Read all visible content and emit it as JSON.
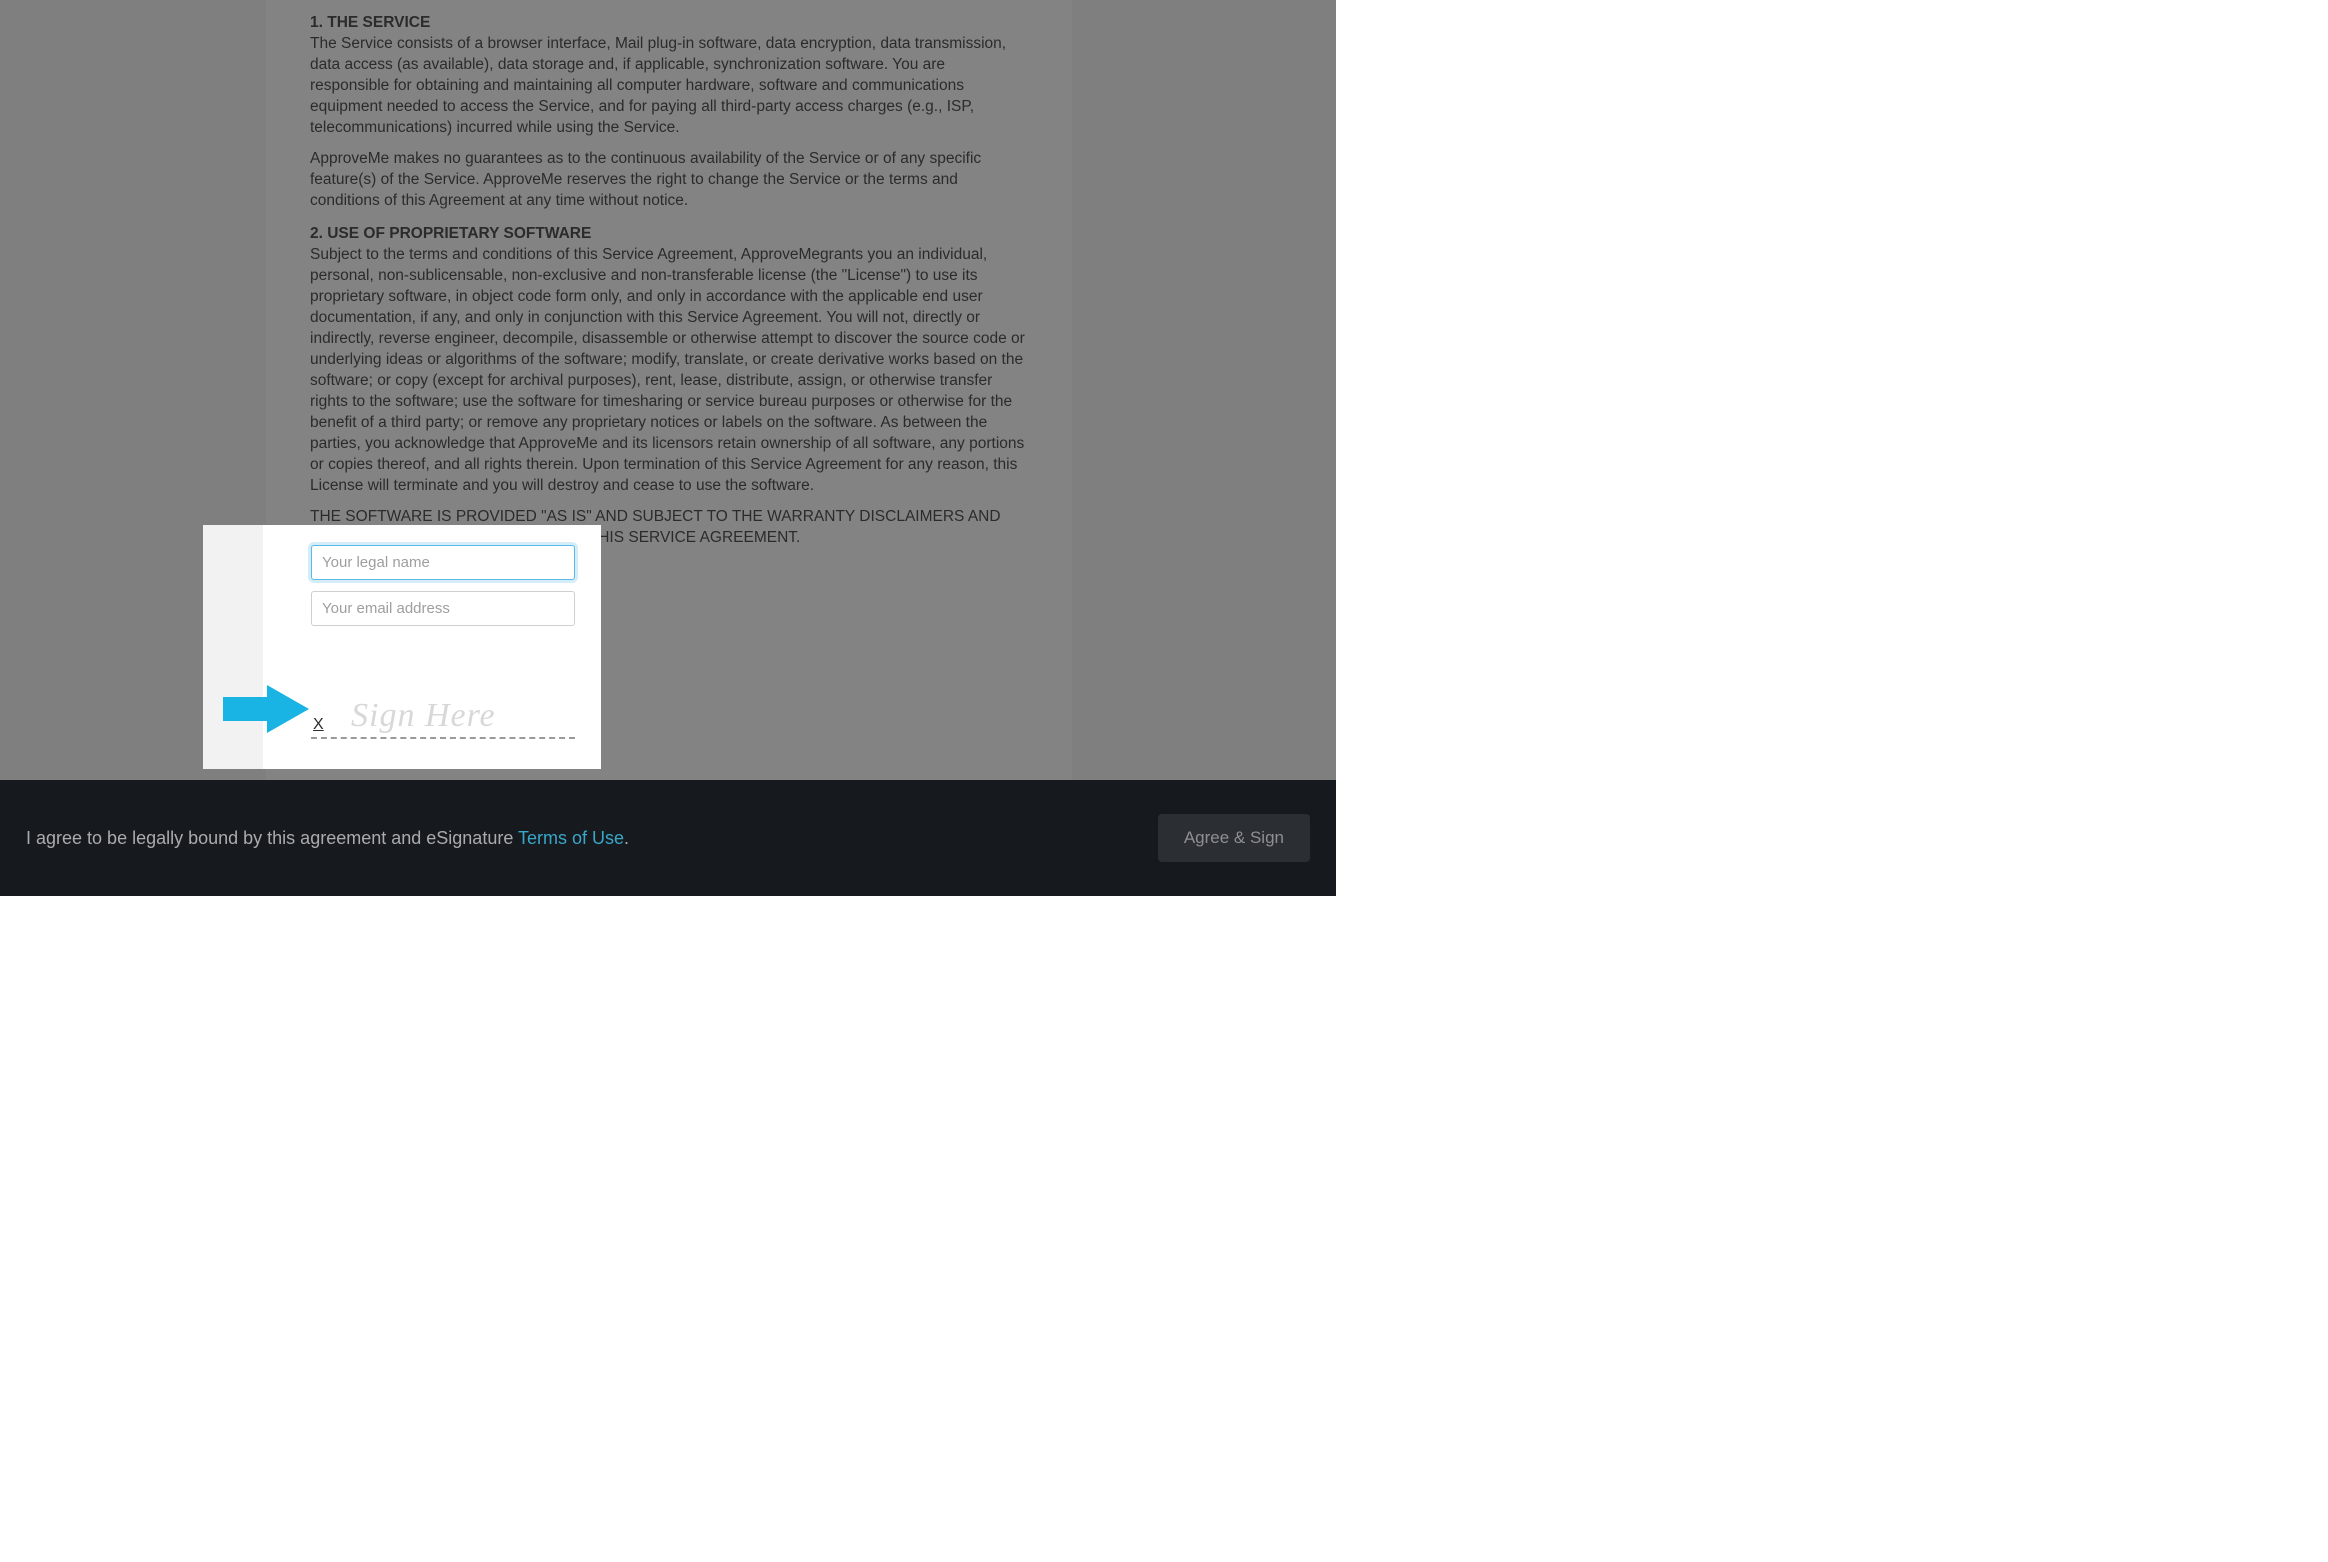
{
  "document": {
    "section1": {
      "title": "1. THE SERVICE",
      "para1": "The Service consists of a browser interface, Mail plug-in software, data encryption, data transmission, data access (as available), data storage and, if applicable, synchronization software. You are responsible for obtaining and maintaining all computer hardware, software and communications equipment needed to access the Service, and for paying all third-party access charges (e.g., ISP, telecommunications) incurred while using the Service.",
      "para2": "ApproveMe makes no guarantees as to the continuous availability of the Service or of any specific feature(s) of the Service. ApproveMe reserves the right to change the Service or the terms and conditions of this Agreement at any time without notice."
    },
    "section2": {
      "title": "2. USE OF PROPRIETARY SOFTWARE",
      "para1": "Subject to the terms and conditions of this Service Agreement, ApproveMegrants you an individual, personal, non-sublicensable, non-exclusive and non-transferable license (the \"License\") to use its proprietary software, in object code form only, and only in accordance with the applicable end user documentation, if any, and only in conjunction with this Service Agreement. You will not, directly or indirectly, reverse engineer, decompile, disassemble or otherwise attempt to discover the source code or underlying ideas or algorithms of the software; modify, translate, or create derivative works based on the software; or copy (except for archival purposes), rent, lease, distribute, assign, or otherwise transfer rights to the software; use the software for timesharing or service bureau purposes or otherwise for the benefit of a third party; or remove any proprietary notices or labels on the software. As between the parties, you acknowledge that ApproveMe and its licensors retain ownership of all software, any portions or copies thereof, and all rights therein. Upon termination of this Service Agreement for any reason, this License will terminate and you will destroy and cease to use the software.",
      "para2": "THE SOFTWARE IS PROVIDED \"AS IS\" AND SUBJECT TO THE WARRANTY DISCLAIMERS AND LIMITATIONS OF LIABILITY FOUND IN THIS SERVICE AGREEMENT."
    }
  },
  "form": {
    "name_placeholder": "Your legal name",
    "email_placeholder": "Your email address",
    "sign_x": "X",
    "sign_placeholder": "Sign Here"
  },
  "footer": {
    "text_prefix": "I agree to be legally bound by this agreement and eSignature ",
    "link_text": "Terms of Use",
    "text_suffix": ".",
    "button_label": "Agree & Sign"
  },
  "colors": {
    "arrow": "#19b4e3",
    "footer_bg": "#16191d",
    "link": "#3aa7c9"
  }
}
